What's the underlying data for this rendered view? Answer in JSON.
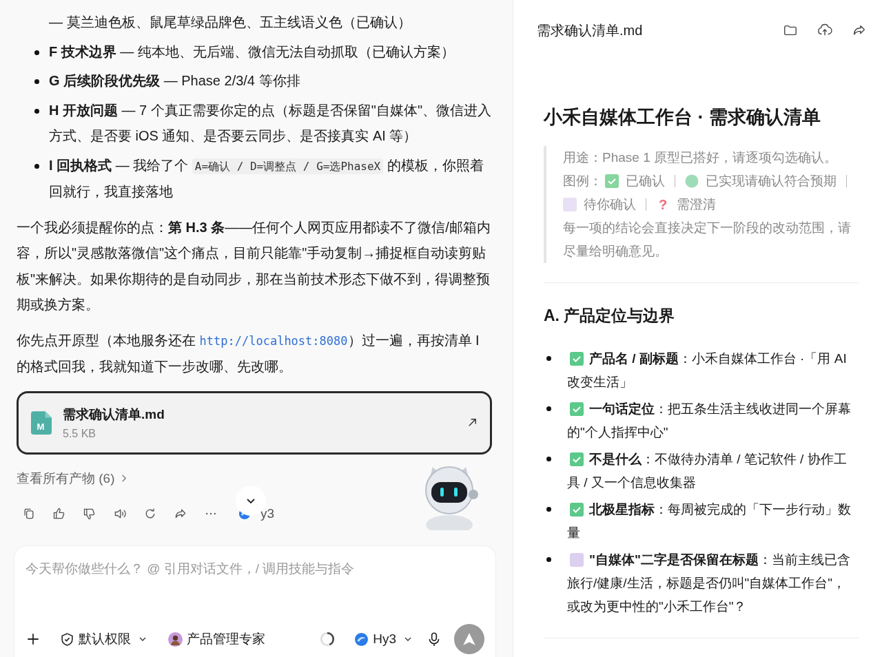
{
  "chat": {
    "list": [
      {
        "segments": [
          {
            "kind": "text",
            "text": "— 莫兰迪色板、鼠尾草绿品牌色、五主线语义色（已确认）"
          }
        ]
      },
      {
        "label": "F 技术边界",
        "segments": [
          {
            "kind": "text",
            "text": " — 纯本地、无后端、微信无法自动抓取（已确认方案）"
          }
        ]
      },
      {
        "label": "G 后续阶段优先级",
        "segments": [
          {
            "kind": "text",
            "text": " — Phase 2/3/4 等你排"
          }
        ]
      },
      {
        "label": "H 开放问题",
        "segments": [
          {
            "kind": "text",
            "text": " — 7 个真正需要你定的点（标题是否保留\"自媒体\"、微信进入方式、是否要 iOS 通知、是否要云同步、是否接真实 AI 等）"
          }
        ]
      },
      {
        "label": "I 回执格式",
        "segments": [
          {
            "kind": "text",
            "text": " — 我给了个 "
          },
          {
            "kind": "code",
            "text": "A=确认 / D=调整点 / G=选PhaseX"
          },
          {
            "kind": "text",
            "text": " 的模板，你照着回就行，我直接落地"
          }
        ]
      }
    ],
    "paragraph": "一个我必须提醒你的点：**第 H.3 条**——任何个人网页应用都读不了微信/邮箱内容，所以\"灵感散落微信\"这个痛点，目前只能靠\"手动复制→捕捉框自动读剪贴板\"来解决。如果你期待的是自动同步，那在当前技术形态下做不到，得调整预期或换方案。",
    "paragraph2": {
      "before": "你先点开原型（本地服务还在 ",
      "link": "http://localhost:8080",
      "after": "）过一遍，再按清单 I 的格式回我，我就知道下一步改哪、先改哪。"
    },
    "attachment": {
      "name": "需求确认清单.md",
      "size": "5.5 KB",
      "badge": "M"
    },
    "artifacts_link": "查看所有产物 (6)",
    "model_tag": "y3"
  },
  "composer": {
    "placeholder": "今天帮你做些什么？ @ 引用对话文件，/ 调用技能与指令",
    "permission": "默认权限",
    "agent": "产品管理专家",
    "model": "Hy3"
  },
  "preview": {
    "file_title": "需求确认清单.md",
    "doc_title": "小禾自媒体工作台 · 需求确认清单",
    "purpose": "用途：Phase 1 原型已搭好，请逐项勾选确认。",
    "legend_label": "图例：",
    "legend": [
      {
        "kind": "confirmed",
        "label": "已确认"
      },
      {
        "kind": "implemented",
        "label": "已实现请确认符合预期"
      },
      {
        "kind": "pending",
        "label": "待你确认"
      },
      {
        "kind": "question",
        "icon": "?",
        "label": "需澄清"
      }
    ],
    "note": "每一项的结论会直接决定下一阶段的改动范围，请尽量给明确意见。",
    "section": "A. 产品定位与边界",
    "items": [
      {
        "kind": "confirmed",
        "label": "产品名 / 副标题",
        "text": "：小禾自媒体工作台 ·「用 AI 改变生活」"
      },
      {
        "kind": "confirmed",
        "label": "一句话定位",
        "text": "：把五条生活主线收进同一个屏幕的\"个人指挥中心\""
      },
      {
        "kind": "confirmed",
        "label": "不是什么",
        "text": "：不做待办清单 / 笔记软件 / 协作工具 / 又一个信息收集器"
      },
      {
        "kind": "confirmed",
        "label": "北极星指标",
        "text": "：每周被完成的「下一步行动」数量"
      },
      {
        "kind": "pending",
        "label": "\"自媒体\"二字是否保留在标题",
        "text": "：当前主线已含旅行/健康/生活，标题是否仍叫\"自媒体工作台\"，或改为更中性的\"小禾工作台\"？"
      }
    ]
  }
}
